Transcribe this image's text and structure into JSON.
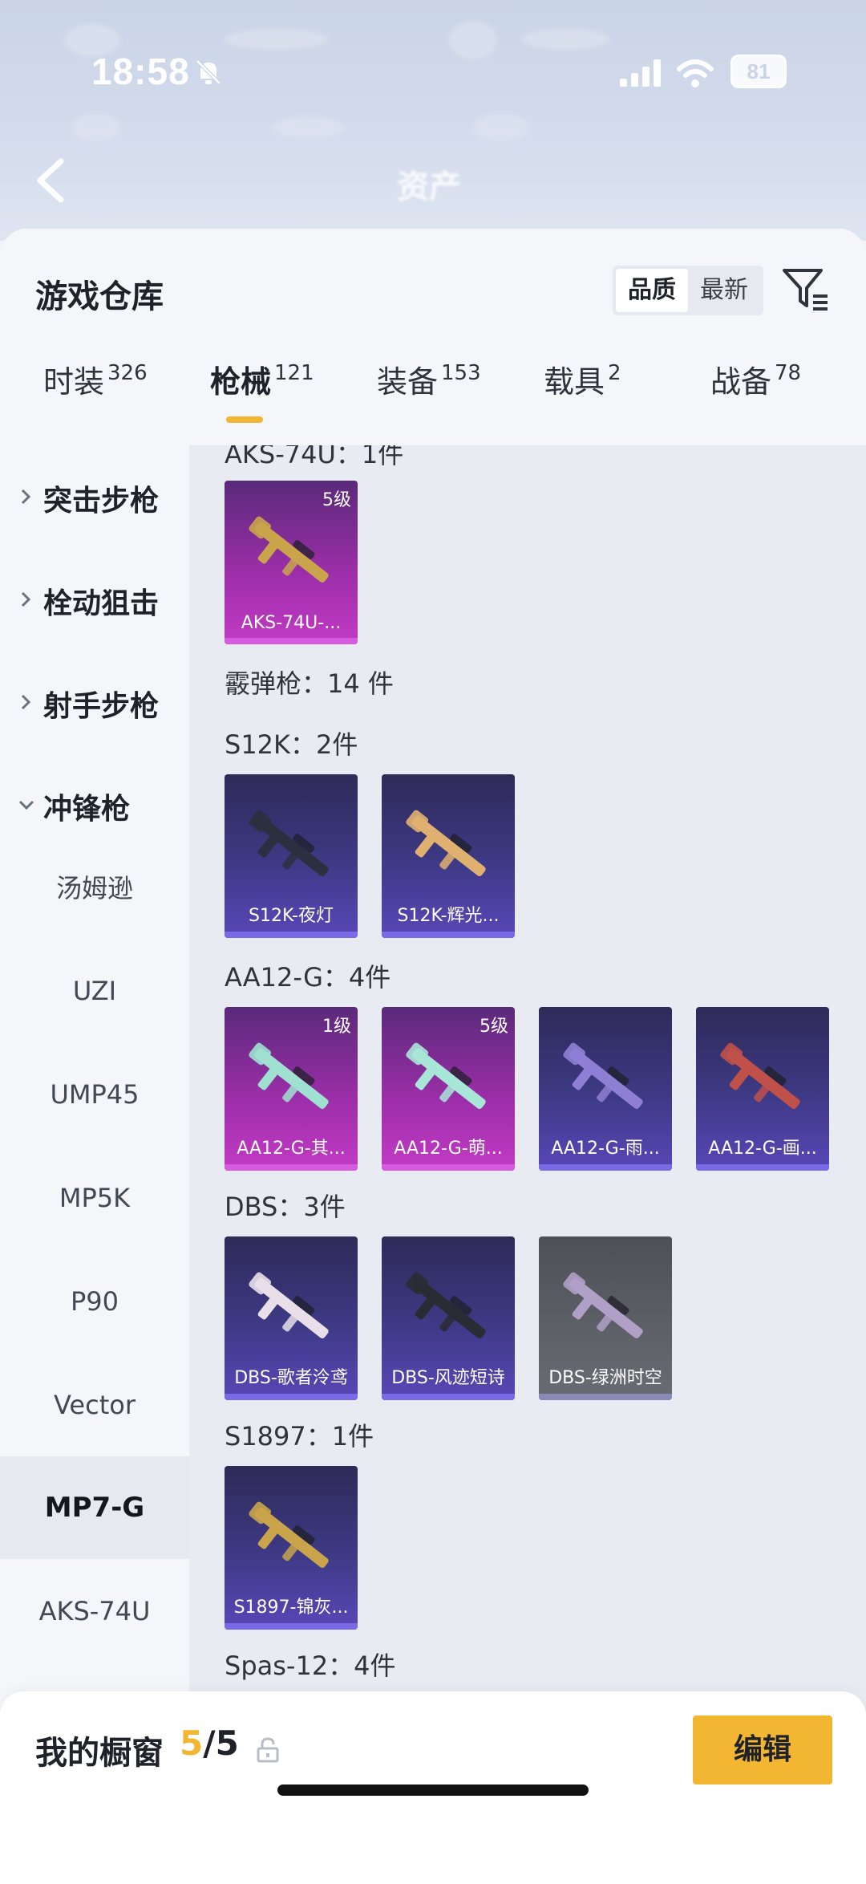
{
  "status_bar": {
    "time": "18:58",
    "battery": "81"
  },
  "header": {
    "title": "资产"
  },
  "sheet": {
    "title": "游戏仓库",
    "sort_options": [
      "品质",
      "最新"
    ],
    "tabs": [
      {
        "label": "时装",
        "count": "326"
      },
      {
        "label": "枪械",
        "count": "121"
      },
      {
        "label": "装备",
        "count": "153"
      },
      {
        "label": "载具",
        "count": "2"
      },
      {
        "label": "战备",
        "count": "78"
      }
    ]
  },
  "sidenav": {
    "categories": [
      "突击步枪",
      "栓动狙击",
      "射手步枪",
      "冲锋枪"
    ],
    "subitems": [
      "汤姆逊",
      "UZI",
      "UMP45",
      "MP5K",
      "P90",
      "Vector",
      "MP7-G",
      "AKS-74U"
    ]
  },
  "content": {
    "partial_top": "AKS-74U：1件",
    "aks_cards": [
      {
        "name": "AKS-74U-...",
        "level": "5级",
        "rarity": "purple"
      }
    ],
    "shotgun_title": "霰弹枪：14 件",
    "groups": [
      {
        "title": "S12K：2件",
        "cards": [
          {
            "name": "S12K-夜灯",
            "level": "",
            "rarity": "blue"
          },
          {
            "name": "S12K-辉光...",
            "level": "",
            "rarity": "blue"
          }
        ]
      },
      {
        "title": "AA12-G：4件",
        "cards": [
          {
            "name": "AA12-G-其...",
            "level": "1级",
            "rarity": "purple"
          },
          {
            "name": "AA12-G-萌...",
            "level": "5级",
            "rarity": "purple"
          },
          {
            "name": "AA12-G-雨...",
            "level": "",
            "rarity": "blue"
          },
          {
            "name": "AA12-G-画...",
            "level": "",
            "rarity": "blue"
          }
        ]
      },
      {
        "title": "DBS：3件",
        "cards": [
          {
            "name": "DBS-歌者泠鸢",
            "level": "",
            "rarity": "blue"
          },
          {
            "name": "DBS-风迹短诗",
            "level": "",
            "rarity": "blue"
          },
          {
            "name": "DBS-绿洲时空",
            "level": "",
            "rarity": "gray"
          }
        ]
      },
      {
        "title": "S1897：1件",
        "cards": [
          {
            "name": "S1897-锦灰...",
            "level": "",
            "rarity": "blue"
          }
        ]
      },
      {
        "title": "Spas-12：4件",
        "cards": []
      }
    ]
  },
  "bottom_bar": {
    "label": "我的橱窗",
    "current": "5",
    "total": "/5",
    "edit_label": "编辑"
  },
  "colors": {
    "accent": "#f2b633",
    "sheet_bg": "#f4f6fa",
    "content_bg": "#e8ebf1"
  }
}
